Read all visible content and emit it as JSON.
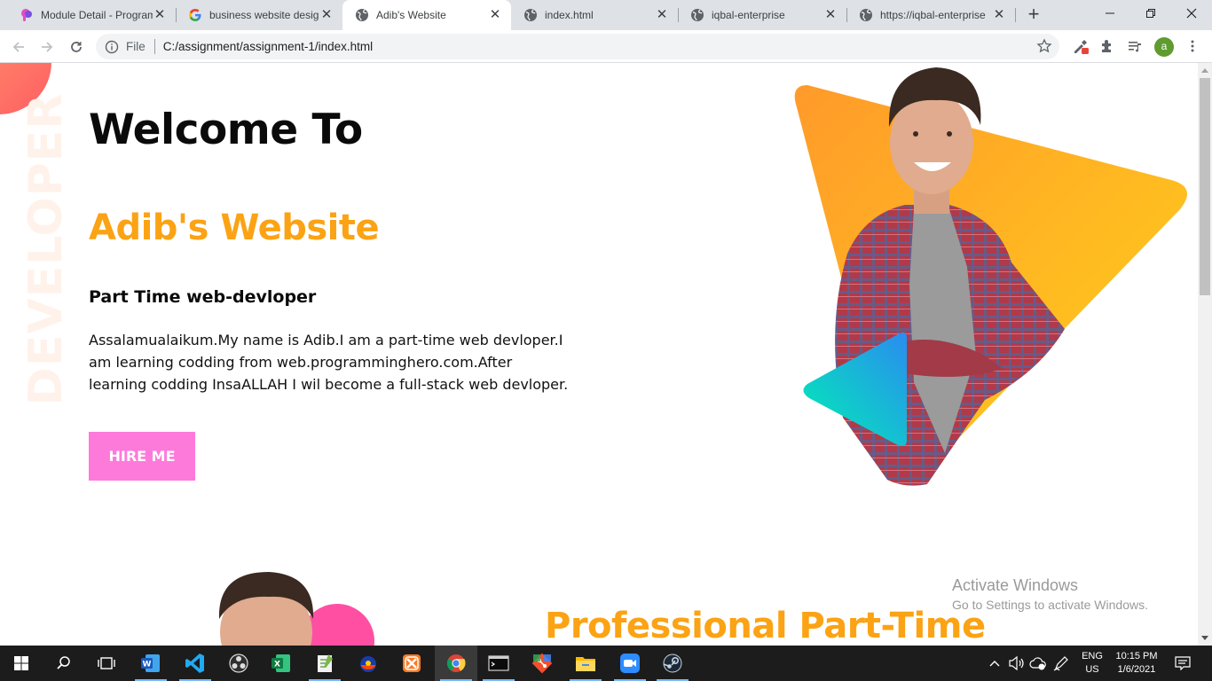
{
  "browser": {
    "tabs": [
      {
        "title": "Module Detail - Programming Hero",
        "active": false,
        "icon": "programming-hero-icon"
      },
      {
        "title": "business website design",
        "active": false,
        "icon": "google-icon"
      },
      {
        "title": "Adib's Website",
        "active": true,
        "icon": "globe-icon"
      },
      {
        "title": "index.html",
        "active": false,
        "icon": "globe-icon"
      },
      {
        "title": "iqbal-enterprise",
        "active": false,
        "icon": "globe-icon"
      },
      {
        "title": "https://iqbal-enterprise",
        "active": false,
        "icon": "globe-icon"
      }
    ],
    "address": {
      "scheme_label": "File",
      "url": "C:/assignment/assignment-1/index.html"
    },
    "profile_initial": "a"
  },
  "page": {
    "side_word": "DEVELOPER",
    "hero": {
      "title": "Welcome To",
      "name": "Adib's Website",
      "role": "Part Time web-devloper",
      "description": "Assalamualaikum.My name is Adib.I am a part-time web devloper.I am learning codding from web.programminghero.com.After learning codding InsaALLAH I wil become a full-stack web devloper.",
      "button": "HIRE ME"
    },
    "section2_title": "Professional Part-Time"
  },
  "os": {
    "watermark": {
      "line1": "Activate Windows",
      "line2": "Go to Settings to activate Windows."
    },
    "language": {
      "line1": "ENG",
      "line2": "US"
    },
    "clock": {
      "time": "10:15 PM",
      "date": "1/6/2021"
    }
  },
  "colors": {
    "accent_orange": "#fba314",
    "button_pink": "#fd7adb",
    "teal": "#00e0c6"
  }
}
